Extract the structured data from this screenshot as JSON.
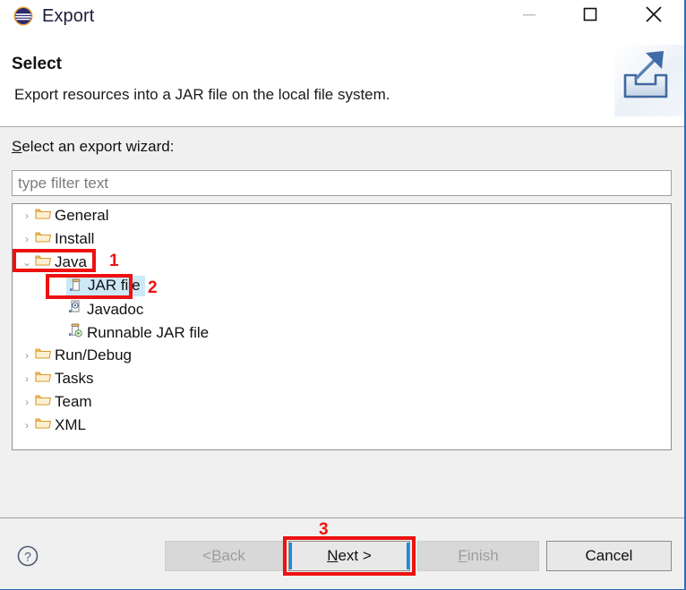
{
  "window": {
    "title": "Export",
    "app_icon": "eclipse-icon",
    "controls": {
      "minimize": "minimize-icon",
      "maximize": "maximize-icon",
      "close": "close-icon"
    }
  },
  "header": {
    "title": "Select",
    "description": "Export resources into a JAR file on the local file system.",
    "icon": "export-wizard-icon"
  },
  "body": {
    "wizard_label_mnemonic": "S",
    "wizard_label_rest": "elect an export wizard:",
    "filter": {
      "value": "",
      "placeholder": "type filter text"
    },
    "tree": [
      {
        "label": "General",
        "level": 0,
        "icon": "folder-icon",
        "twisty": "›",
        "expanded": false,
        "selected": false
      },
      {
        "label": "Install",
        "level": 0,
        "icon": "folder-icon",
        "twisty": "›",
        "expanded": false,
        "selected": false
      },
      {
        "label": "Java",
        "level": 0,
        "icon": "folder-icon",
        "twisty": "⌄",
        "expanded": true,
        "selected": false
      },
      {
        "label": "JAR file",
        "level": 1,
        "icon": "jar-file-icon",
        "twisty": "",
        "expanded": false,
        "selected": true
      },
      {
        "label": "Javadoc",
        "level": 1,
        "icon": "javadoc-icon",
        "twisty": "",
        "expanded": false,
        "selected": false
      },
      {
        "label": "Runnable JAR file",
        "level": 1,
        "icon": "runnable-jar-icon",
        "twisty": "",
        "expanded": false,
        "selected": false
      },
      {
        "label": "Run/Debug",
        "level": 0,
        "icon": "folder-icon",
        "twisty": "›",
        "expanded": false,
        "selected": false
      },
      {
        "label": "Tasks",
        "level": 0,
        "icon": "folder-icon",
        "twisty": "›",
        "expanded": false,
        "selected": false
      },
      {
        "label": "Team",
        "level": 0,
        "icon": "folder-icon",
        "twisty": "›",
        "expanded": false,
        "selected": false
      },
      {
        "label": "XML",
        "level": 0,
        "icon": "folder-icon",
        "twisty": "›",
        "expanded": false,
        "selected": false
      }
    ]
  },
  "footer": {
    "help_icon": "help-icon",
    "buttons": {
      "back": {
        "prefix": "< ",
        "mnemonic": "B",
        "suffix": "ack",
        "enabled": false
      },
      "next": {
        "prefix": "",
        "mnemonic": "N",
        "suffix": "ext >",
        "enabled": true
      },
      "finish": {
        "prefix": "",
        "mnemonic": "F",
        "suffix": "inish",
        "enabled": false
      },
      "cancel": {
        "prefix": "",
        "mnemonic": "",
        "suffix": "Cancel",
        "enabled": true
      }
    }
  },
  "annotations": {
    "step_1": "1",
    "step_2": "2",
    "step_3": "3",
    "color": "#ee1111"
  }
}
